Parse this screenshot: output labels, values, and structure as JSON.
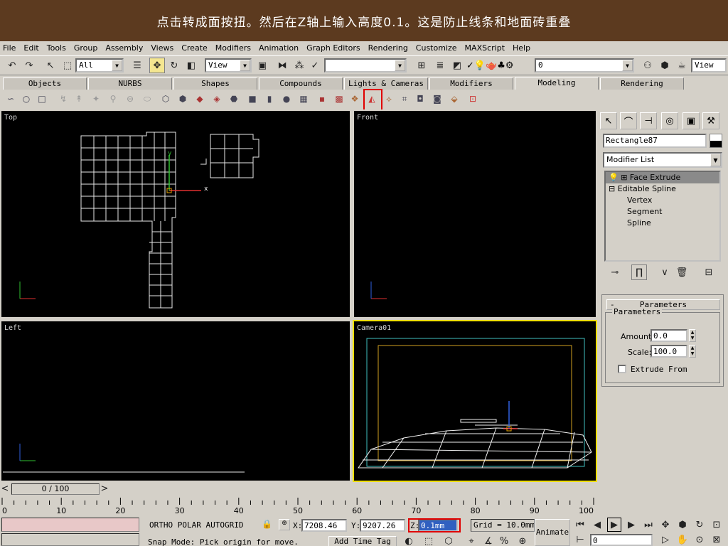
{
  "banner": {
    "text": "点击转成面按扭。然后在Z轴上输入高度0.1。这是防止线条和地面砖重叠"
  },
  "menu": [
    "File",
    "Edit",
    "Tools",
    "Group",
    "Assembly",
    "Views",
    "Create",
    "Modifiers",
    "Animation",
    "Graph Editors",
    "Rendering",
    "Customize",
    "MAXScript",
    "Help"
  ],
  "toolbar": {
    "selection_filter": "All",
    "reference_coord": "View",
    "named_selection": "",
    "layer": "0",
    "render_view": "View"
  },
  "tabs": [
    "Objects",
    "NURBS",
    "Shapes",
    "Compounds",
    "Lights & Cameras",
    "Modifiers",
    "Modeling",
    "Rendering"
  ],
  "active_tab": "Modeling",
  "viewports": {
    "top": "Top",
    "front": "Front",
    "left": "Left",
    "camera": "Camera01",
    "axis_x": "x",
    "axis_y": "y"
  },
  "command_panel": {
    "object_name": "Rectangle87",
    "modifier_list": "Modifier List",
    "stack": [
      "Face Extrude",
      "Editable Spline",
      "Vertex",
      "Segment",
      "Spline"
    ],
    "parameters_title": "Parameters",
    "parameters_group": "Parameters",
    "amount_label": "Amount:",
    "amount_value": "0.0",
    "scale_label": "Scale:",
    "scale_value": "100.0",
    "extrude_from_label": "Extrude From"
  },
  "timeline": {
    "frame_display": "0 / 100",
    "ticks": [
      "0",
      "10",
      "20",
      "30",
      "40",
      "50",
      "60",
      "70",
      "80",
      "90",
      "100"
    ]
  },
  "status": {
    "snap_modes": "ORTHO  POLAR  AUTOGRID",
    "x_label": "X:",
    "x_value": "7208.46",
    "y_label": "Y:",
    "y_value": "9207.26",
    "z_label": "Z:",
    "z_value": "0.1mm",
    "grid": "Grid = 10.0mm",
    "prompt": "Snap Mode: Pick origin for move.",
    "add_time_tag": "Add Time Tag",
    "animate": "Animate",
    "current_frame": "0"
  },
  "colors": {
    "banner_bg": "#5c3a1f",
    "highlight": "#e00000",
    "active_viewport": "#f0e000",
    "spline": "#e8e8e8"
  }
}
